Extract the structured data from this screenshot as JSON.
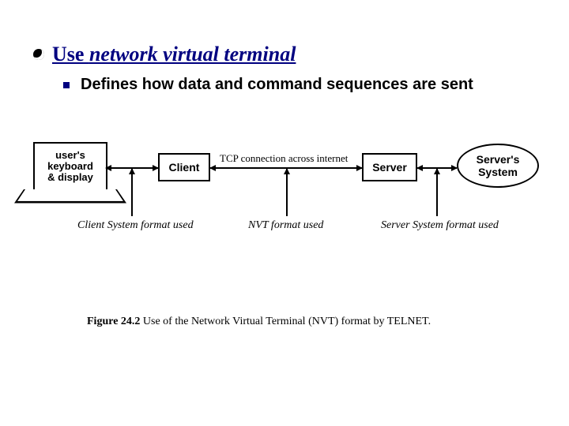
{
  "heading": {
    "plain": "Use ",
    "ital": "network virtual terminal"
  },
  "subpoint": "Defines how data and command sequences are sent",
  "diagram": {
    "user_box": "user's\nkeyboard\n& display",
    "client_box": "Client",
    "server_box": "Server",
    "servers_system": "Server's\nSystem",
    "tcp_label": "TCP connection across internet",
    "fmt_client": "Client System format used",
    "fmt_nvt": "NVT format used",
    "fmt_server": "Server System format used"
  },
  "caption": {
    "fig": "Figure 24.2",
    "rest": " Use of the Network Virtual Terminal (NVT) format by TELNET."
  }
}
